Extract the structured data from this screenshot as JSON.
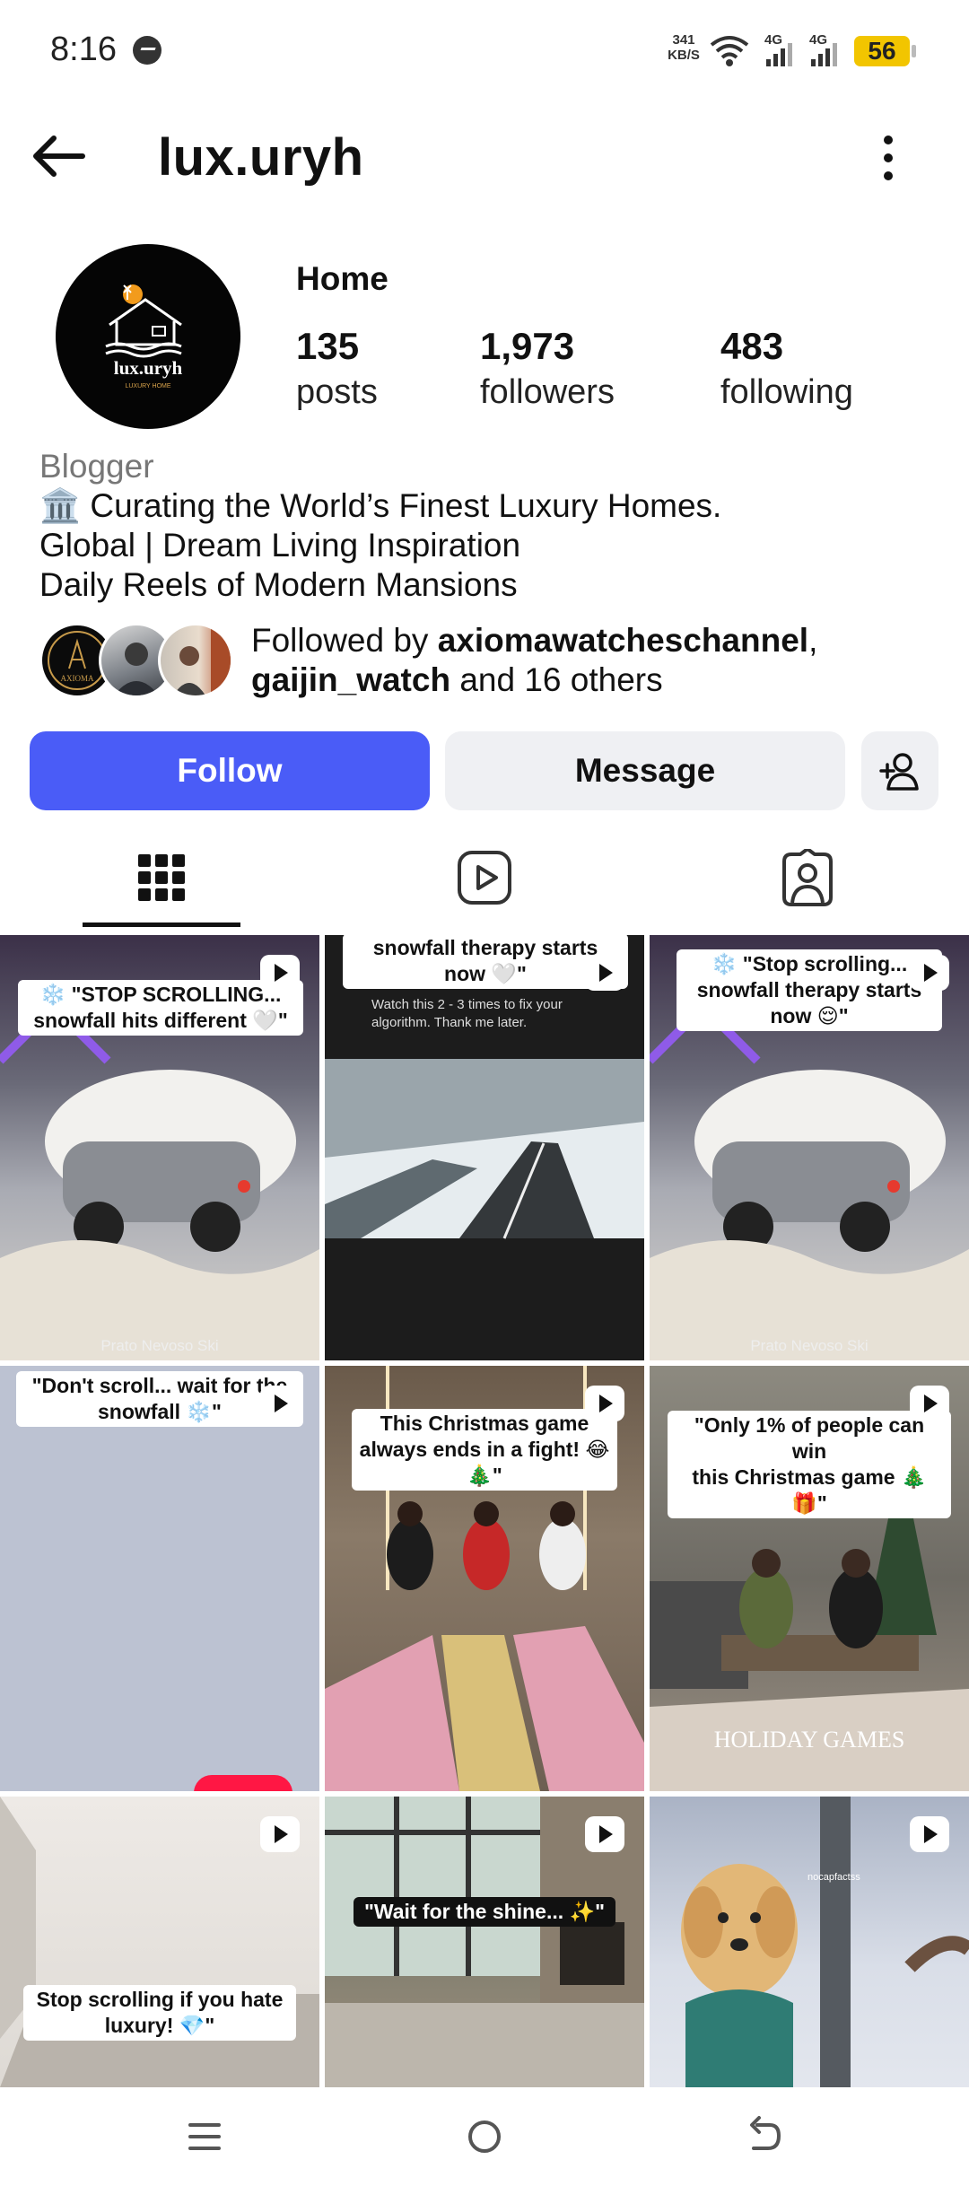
{
  "status_bar": {
    "time": "8:16",
    "speed_value": "341",
    "speed_unit": "KB/S",
    "net1": "4G",
    "net2": "4G",
    "battery": "56"
  },
  "header": {
    "username": "lux.uryh"
  },
  "profile": {
    "avatar_brand": "lux.uryh",
    "avatar_tag": "LUXURY HOME",
    "category_title": "Home",
    "stats": [
      {
        "number": "135",
        "label": "posts"
      },
      {
        "number": "1,973",
        "label": "followers"
      },
      {
        "number": "483",
        "label": "following"
      }
    ],
    "bio_category": "Blogger",
    "bio_lines": [
      "🏛️ Curating the World’s Finest Luxury Homes.",
      "Global | Dream Living Inspiration",
      "Daily Reels of Modern Mansions"
    ],
    "followed_by": {
      "prefix": "Followed by ",
      "user1": "axiomawatcheschannel",
      "separator": ",",
      "user2": "gaijin_watch",
      "suffix": " and 16 others",
      "avatar1_text": "AXIOMA"
    }
  },
  "actions": {
    "follow": "Follow",
    "message": "Message"
  },
  "posts": [
    {
      "caption": "❄️ \"STOP SCROLLING...\nsnowfall hits different 🤍\"",
      "location": "Prato Nevoso Ski"
    },
    {
      "caption": "snowfall therapy starts\nnow 🤍\"",
      "sub": "Watch this 2 - 3 times to fix your\nalgorithm. Thank me later."
    },
    {
      "caption": "❄️ \"Stop scrolling...\nsnowfall therapy starts\nnow 😌\"",
      "location": "Prato Nevoso Ski"
    },
    {
      "caption": "\"Don't scroll... wait for the\nsnowfall ❄️\""
    },
    {
      "caption": "This Christmas game\nalways ends in a fight! 😂\n🎄\""
    },
    {
      "caption": "\"Only 1% of people can win\nthis Christmas game 🎄\n🎁\"",
      "overlay": "HOLIDAY GAMES"
    },
    {
      "caption": "Stop scrolling if you hate\nluxury! 💎\""
    },
    {
      "caption": "\"Wait for the shine... ✨\""
    },
    {
      "caption": "",
      "watermark": "nocapfactss"
    }
  ],
  "colors": {
    "follow_button": "#4a5cf7",
    "secondary_button": "#eff0f3",
    "battery": "#f2c500"
  }
}
